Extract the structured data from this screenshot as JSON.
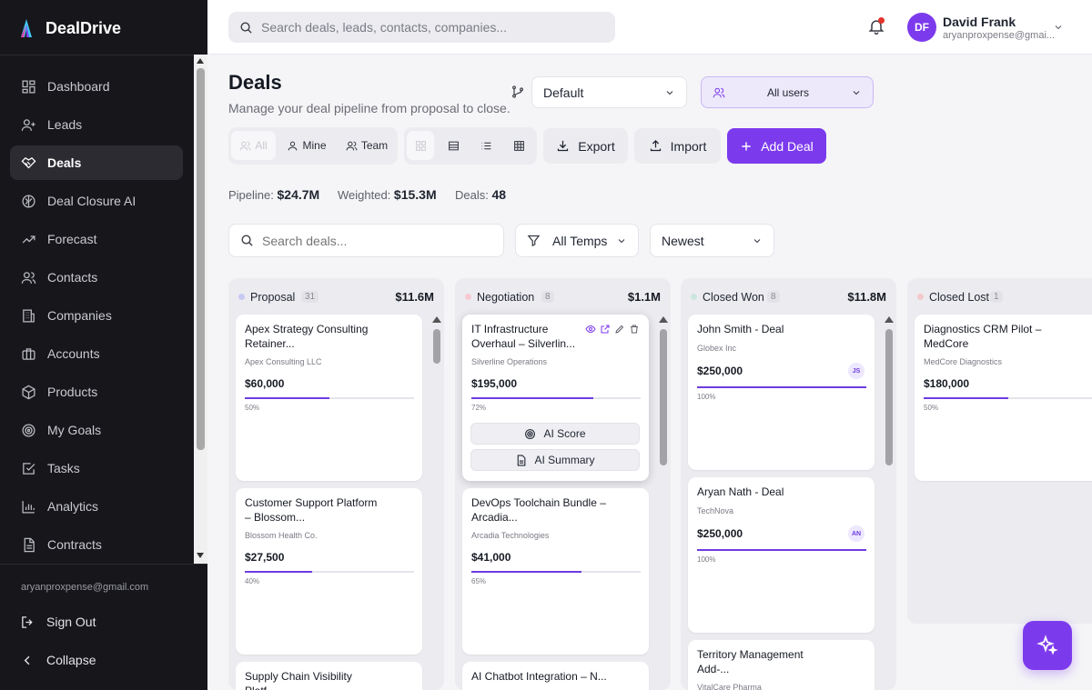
{
  "app": {
    "name": "DealDrive"
  },
  "sidebar": {
    "items": [
      {
        "label": "Dashboard",
        "icon": "dashboard-icon"
      },
      {
        "label": "Leads",
        "icon": "user-plus-icon"
      },
      {
        "label": "Deals",
        "icon": "handshake-icon",
        "active": true
      },
      {
        "label": "Deal Closure AI",
        "icon": "brain-icon"
      },
      {
        "label": "Forecast",
        "icon": "trend-icon"
      },
      {
        "label": "Contacts",
        "icon": "users-icon"
      },
      {
        "label": "Companies",
        "icon": "building-icon"
      },
      {
        "label": "Accounts",
        "icon": "briefcase-icon"
      },
      {
        "label": "Products",
        "icon": "package-icon"
      },
      {
        "label": "My Goals",
        "icon": "target-icon"
      },
      {
        "label": "Tasks",
        "icon": "checkbox-icon"
      },
      {
        "label": "Analytics",
        "icon": "bar-chart-icon"
      },
      {
        "label": "Contracts",
        "icon": "document-icon"
      }
    ],
    "user_email": "aryanproxpense@gmail.com",
    "sign_out": "Sign Out",
    "collapse": "Collapse"
  },
  "topbar": {
    "search_placeholder": "Search deals, leads, contacts, companies...",
    "user": {
      "initials": "DF",
      "name": "David Frank",
      "email": "aryanproxpense@gmai..."
    }
  },
  "page": {
    "title": "Deals",
    "subtitle": "Manage your deal pipeline from proposal to close."
  },
  "controls": {
    "pipeline_select": "Default",
    "users_select": "All users",
    "scope": {
      "all": "All",
      "mine": "Mine",
      "team": "Team"
    },
    "export": "Export",
    "import": "Import",
    "add_deal": "Add Deal"
  },
  "stats": {
    "pipeline_label": "Pipeline:",
    "pipeline_value": "$24.7M",
    "weighted_label": "Weighted:",
    "weighted_value": "$15.3M",
    "deals_label": "Deals:",
    "deals_value": "48"
  },
  "filters": {
    "search_placeholder": "Search deals...",
    "temps": "All Temps",
    "sort": "Newest"
  },
  "columns": [
    {
      "name": "Proposal",
      "count": "31",
      "total": "$11.6M",
      "dot": "#c7c9f4",
      "cards": [
        {
          "title": "Apex Strategy Consulting Retainer...",
          "company": "Apex Consulting LLC",
          "amount": "$60,000",
          "pct": "50%",
          "progress": 0.5
        },
        {
          "title": "Customer Support Platform – Blossom...",
          "company": "Blossom Health Co.",
          "amount": "$27,500",
          "pct": "40%",
          "progress": 0.4
        },
        {
          "title": "Supply Chain Visibility Platf..."
        }
      ]
    },
    {
      "name": "Negotiation",
      "count": "8",
      "total": "$1.1M",
      "dot": "#f6c9d3",
      "cards": [
        {
          "title": "IT Infrastructure Overhaul – Silverlin...",
          "company": "Silverline Operations",
          "amount": "$195,000",
          "pct": "72%",
          "progress": 0.72,
          "ai_score": "AI Score",
          "ai_summary": "AI Summary"
        },
        {
          "title": "DevOps Toolchain Bundle – Arcadia...",
          "company": "Arcadia Technologies",
          "amount": "$41,000",
          "pct": "65%",
          "progress": 0.65
        },
        {
          "title": "AI Chatbot Integration – N..."
        }
      ]
    },
    {
      "name": "Closed Won",
      "count": "8",
      "total": "$11.8M",
      "dot": "#cbe6dc",
      "cards": [
        {
          "title": "John Smith - Deal",
          "company": "Globex Inc",
          "amount": "$250,000",
          "pct": "100%",
          "progress": 1.0,
          "initials": "JS"
        },
        {
          "title": "Aryan Nath - Deal",
          "company": "TechNova",
          "amount": "$250,000",
          "pct": "100%",
          "progress": 1.0,
          "initials": "AN"
        },
        {
          "title": "Territory Management Add-...",
          "company": "VitalCare Pharma"
        }
      ]
    },
    {
      "name": "Closed Lost",
      "count": "1",
      "total": "",
      "dot": "#f3c9cc",
      "cards": [
        {
          "title": "Diagnostics CRM Pilot – MedCore",
          "company": "MedCore Diagnostics",
          "amount": "$180,000",
          "pct": "50%",
          "progress": 0.5
        }
      ]
    }
  ],
  "colors": {
    "accent": "#7c3aed",
    "sidebar_bg": "#17171b",
    "progress": "#6d3ce0"
  }
}
